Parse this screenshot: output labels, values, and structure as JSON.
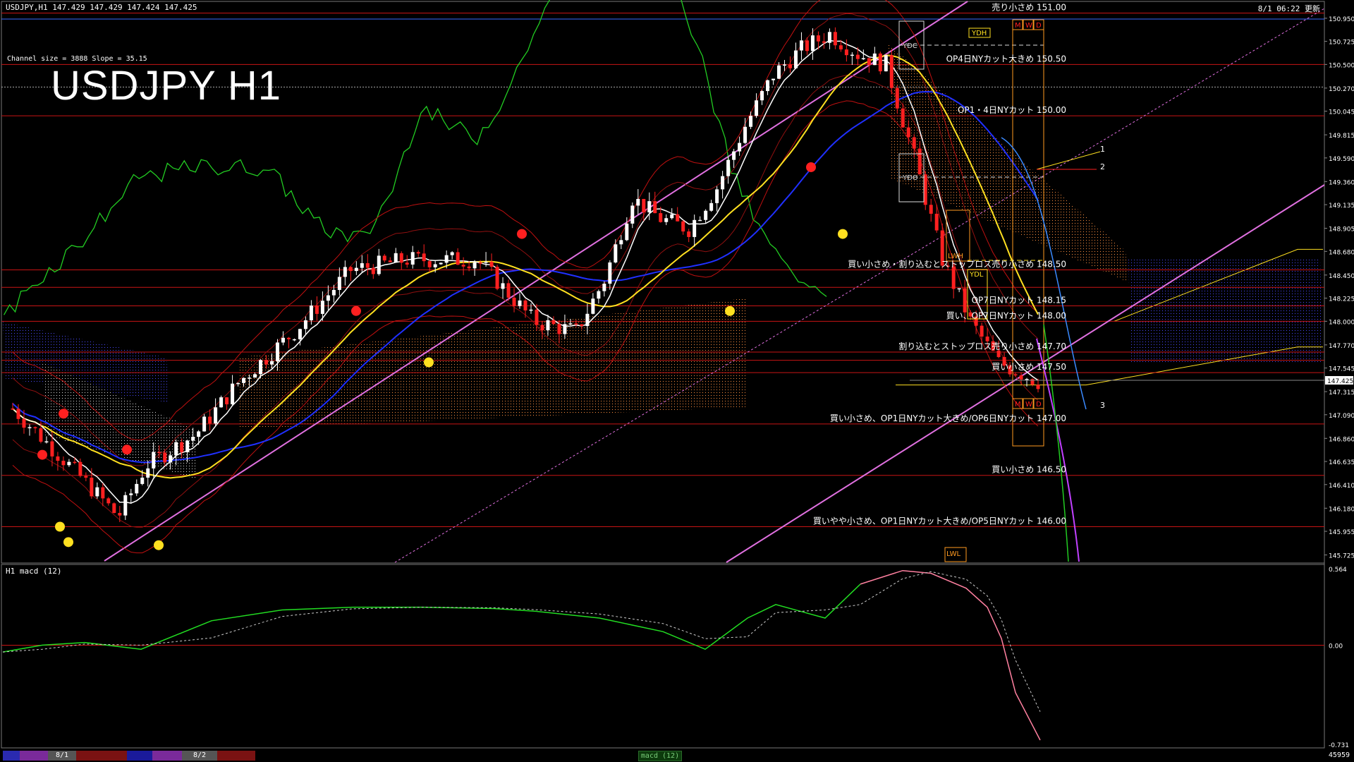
{
  "header": {
    "symbol_info": "USDJPY,H1  147.429 147.429 147.424 147.425",
    "timestamp": "8/1 06:22 更新"
  },
  "chart_overlay": {
    "channel_info": "Channel size = 3888 Slope = 35.15",
    "title": "USDJPY H1"
  },
  "macd_panel": {
    "title": "H1  macd (12)",
    "axis_labels": [
      "0.564",
      "0.00",
      "-0.731"
    ]
  },
  "price_axis": {
    "labels": [
      "150.950",
      "150.725",
      "150.500",
      "150.270",
      "150.045",
      "149.815",
      "149.590",
      "149.360",
      "149.135",
      "148.905",
      "148.680",
      "148.450",
      "148.225",
      "148.000",
      "147.770",
      "147.545",
      "147.315",
      "147.090",
      "146.860",
      "146.635",
      "146.410",
      "146.180",
      "145.955",
      "145.725"
    ],
    "current_price": "147.425"
  },
  "levels": [
    {
      "label": "売り小さめ 151.00",
      "price": 151.0
    },
    {
      "label": "OP4日NYカット大きめ 150.50",
      "price": 150.5
    },
    {
      "label": "OP1・4日NYカット 150.00",
      "price": 150.0
    },
    {
      "label": "買い小さめ・割り込むとストップロス売り小さめ 148.50",
      "price": 148.5
    },
    {
      "label": "OP7日NYカット 148.15",
      "price": 148.15
    },
    {
      "label": "買い、OP7日NYカット 148.00",
      "price": 148.0
    },
    {
      "label": "割り込むとストップロス売り小さめ 147.70",
      "price": 147.7
    },
    {
      "label": "買い小さめ 147.50",
      "price": 147.5
    },
    {
      "label": "買い小さめ、OP1日NYカット大きめ/OP6日NYカット 147.00",
      "price": 147.0
    },
    {
      "label": "買い小さめ 146.50",
      "price": 146.5
    },
    {
      "label": "買いやや小さめ、OP1日NYカット大きめ/OP5日NYカット 146.00",
      "price": 146.0
    }
  ],
  "markers": {
    "ydh": "YDH",
    "ydc": "YDC",
    "ydo": "YDO",
    "ydl": "YDL",
    "lwh": "LWH",
    "lwl": "LWL",
    "mwd": [
      "M",
      "W",
      "D"
    ],
    "projection_labels": [
      "1",
      "2",
      "3"
    ]
  },
  "bottom_bar": {
    "dates": [
      "8/1",
      "8/2"
    ],
    "macd_tab": "macd (12)",
    "bar_count": "45959"
  },
  "colors": {
    "background": "#000000",
    "level_line": "#c81414",
    "channel": "#e070e0",
    "ma_white": "#ffffff",
    "ma_yellow": "#ffe020",
    "ma_blue": "#2030ff",
    "chikou_green": "#22cc22",
    "bull_candle": "#ffffff",
    "bear_candle": "#ff2020",
    "cloud_bear": "#ff9040",
    "cloud_bull": "#3a3aff",
    "macd_up": "#22dd22",
    "macd_down": "#ff80a0"
  }
}
